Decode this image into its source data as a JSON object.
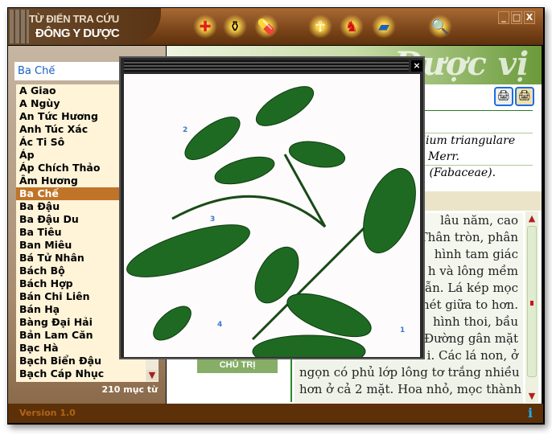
{
  "app": {
    "title_line1": "TỪ ĐIỂN TRA CỨU",
    "title_line2": "ĐÔNG Y DƯỢC"
  },
  "toolbar": [
    {
      "name": "first-aid-icon",
      "glyph": "✚"
    },
    {
      "name": "medicine-bottles-icon",
      "glyph": "⚱"
    },
    {
      "name": "pills-icon",
      "glyph": "💊"
    },
    {
      "name": "acupuncture-body-icon",
      "glyph": "☥"
    },
    {
      "name": "anatomy-icon",
      "glyph": "♞"
    },
    {
      "name": "medicine-box-icon",
      "glyph": "▰"
    },
    {
      "name": "magnifier-icon",
      "glyph": "🔍"
    }
  ],
  "window_controls": {
    "minimize": "_",
    "maximize": "□",
    "close": "X"
  },
  "search": {
    "value": "Ba Chế"
  },
  "list": {
    "items": [
      "A Giao",
      "A Ngùy",
      "An Tức Hương",
      "Anh Túc Xác",
      "Ác Ti Sô",
      "Áp",
      "Áp Chích Thảo",
      "Âm Hương",
      "Ba Chế",
      "Ba Đậu",
      "Ba Đậu Du",
      "Ba Tiêu",
      "Ban Miêu",
      "Bá Tử Nhân",
      "Bách Bộ",
      "Bách Hợp",
      "Bán Chi Liên",
      "Bán Hạ",
      "Bàng Đại Hải",
      "Bản Lam Căn",
      "Bạc Hà",
      "Bạch Biển Đậu",
      "Bạch Cáp Nhục"
    ],
    "selected": "Ba Chế",
    "count": "210 mục từ"
  },
  "footer": {
    "version": "Version 1.0"
  },
  "header": {
    "title": "Dược vị"
  },
  "detail": {
    "scientific": [
      "dium triangulare",
      "Merr.",
      "u (Fabaceae)."
    ],
    "section_label": "CHỦ TRỊ",
    "body_lines": [
      "lâu năm, cao",
      "Thân tròn, phân",
      "hình tam giác",
      "h và lông mềm",
      "ẫn. Lá kép mọc",
      "hét giữa to hơn.",
      "hình thoi, bầu",
      "Đường gân mặt",
      "i. Các lá non, ở",
      "ngọn có phủ lớp lông tơ trắng nhiều",
      "hơn ở cả 2 mặt. Hoa nhỏ, mọc thành"
    ]
  },
  "popup": {
    "close": "×",
    "labels": [
      "1",
      "2",
      "3",
      "4"
    ]
  },
  "colors": {
    "selected": "#c07428",
    "footer": "#5c3008",
    "accent_green": "#86ae66"
  }
}
